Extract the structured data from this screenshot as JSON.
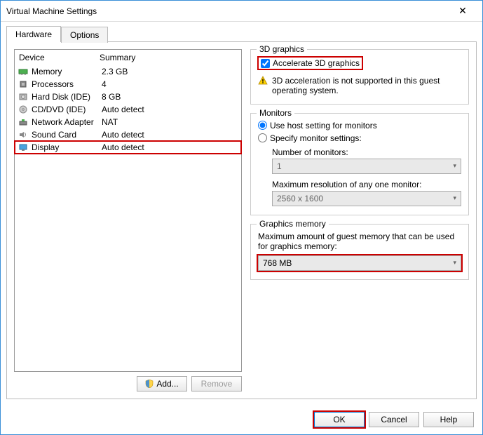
{
  "window": {
    "title": "Virtual Machine Settings"
  },
  "tabs": {
    "hardware": "Hardware",
    "options": "Options"
  },
  "list": {
    "header_device": "Device",
    "header_summary": "Summary",
    "rows": [
      {
        "icon": "memory",
        "device": "Memory",
        "summary": "2.3 GB"
      },
      {
        "icon": "cpu",
        "device": "Processors",
        "summary": "4"
      },
      {
        "icon": "disk",
        "device": "Hard Disk (IDE)",
        "summary": "8 GB"
      },
      {
        "icon": "cd",
        "device": "CD/DVD (IDE)",
        "summary": "Auto detect"
      },
      {
        "icon": "net",
        "device": "Network Adapter",
        "summary": "NAT"
      },
      {
        "icon": "sound",
        "device": "Sound Card",
        "summary": "Auto detect"
      },
      {
        "icon": "display",
        "device": "Display",
        "summary": "Auto detect"
      }
    ],
    "add_label": "Add...",
    "remove_label": "Remove"
  },
  "g3d": {
    "legend": "3D graphics",
    "accel_label": "Accelerate 3D graphics",
    "warn_text": "3D acceleration is not supported in this guest operating system."
  },
  "monitors": {
    "legend": "Monitors",
    "use_host_label": "Use host setting for monitors",
    "specify_label": "Specify monitor settings:",
    "num_label": "Number of monitors:",
    "num_value": "1",
    "max_label": "Maximum resolution of any one monitor:",
    "max_value": "2560 x 1600"
  },
  "gmem": {
    "legend": "Graphics memory",
    "desc": "Maximum amount of guest memory that can be used for graphics memory:",
    "value": "768 MB"
  },
  "footer": {
    "ok": "OK",
    "cancel": "Cancel",
    "help": "Help"
  }
}
